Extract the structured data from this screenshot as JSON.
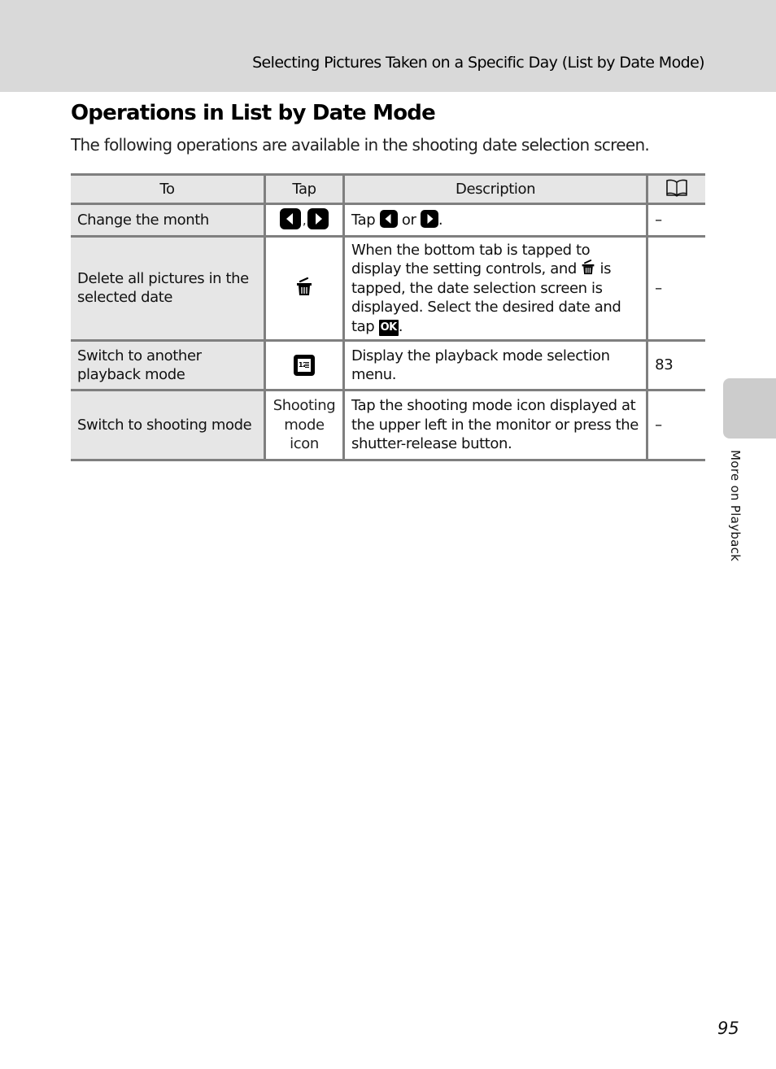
{
  "header": {
    "section_title": "Selecting Pictures Taken on a Specific Day (List by Date Mode)"
  },
  "main": {
    "title": "Operations in List by Date Mode",
    "intro": "The following operations are available in the shooting date selection screen."
  },
  "table": {
    "headers": {
      "to": "To",
      "tap": "Tap",
      "description": "Description",
      "reference_icon": "book-icon"
    },
    "rows": [
      {
        "to": "Change the month",
        "tap_icons": [
          "left-arrow-key-icon",
          "right-arrow-key-icon"
        ],
        "tap_separator": ",",
        "description": {
          "part1": "Tap",
          "part2": "or",
          "part3": "."
        },
        "ref": "–"
      },
      {
        "to": "Delete all pictures in the selected date",
        "tap_icons": [
          "trash-icon"
        ],
        "description": {
          "part1": "When the bottom tab is tapped to display the setting controls, and",
          "part2": "is tapped, the date selection screen is displayed. Select the desired date and tap",
          "ok_label": "OK",
          "part3": "."
        },
        "ref": "–"
      },
      {
        "to": "Switch to another playback mode",
        "tap_icons": [
          "playback-mode-icon"
        ],
        "tap_icon_text": "12",
        "description": "Display the playback mode selection menu.",
        "ref": "83"
      },
      {
        "to": "Switch to shooting mode",
        "tap_text": "Shooting mode icon",
        "description": "Tap the shooting mode icon displayed at the upper left in the monitor or press the shutter-release button.",
        "ref": "–"
      }
    ]
  },
  "side_tab": {
    "label": "More on Playback"
  },
  "footer": {
    "page_number": "95"
  }
}
